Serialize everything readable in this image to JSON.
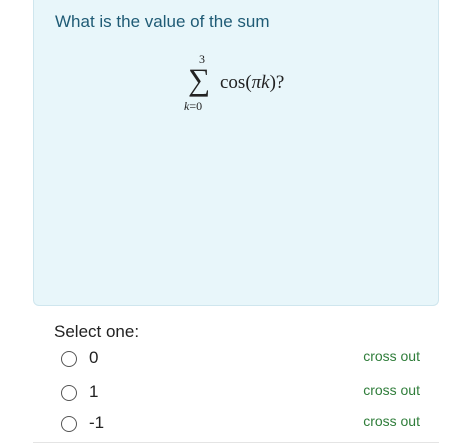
{
  "question": {
    "text": "What is the value of the sum",
    "formula": {
      "upper_limit": "3",
      "sigma": "∑",
      "lower_index": "k",
      "lower_equals": "=0",
      "summand_prefix": "cos(",
      "summand_var": "πk",
      "summand_suffix": ")?"
    }
  },
  "answer": {
    "prompt": "Select one:",
    "options": [
      {
        "label": "0",
        "cross_out": "cross out"
      },
      {
        "label": "1",
        "cross_out": "cross out"
      },
      {
        "label": "-1",
        "cross_out": "cross out"
      }
    ]
  },
  "colors": {
    "question_background": "#e8f6fa",
    "question_text": "#1f5b75",
    "cross_out_link": "#2f7d3a"
  }
}
